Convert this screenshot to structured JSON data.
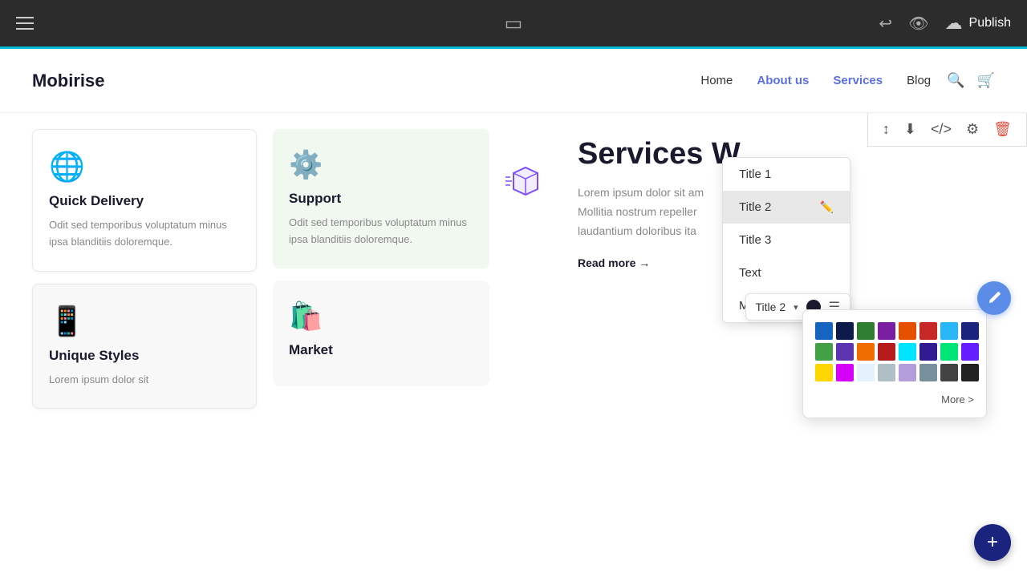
{
  "topbar": {
    "publish_label": "Publish",
    "phone_icon": "📱"
  },
  "navbar": {
    "logo": "Mobirise",
    "links": [
      {
        "label": "Home",
        "id": "home"
      },
      {
        "label": "About us",
        "id": "about"
      },
      {
        "label": "Services",
        "id": "services"
      },
      {
        "label": "Blog",
        "id": "blog"
      }
    ]
  },
  "float_toolbar": {
    "icons": [
      "↕",
      "⬇",
      "</>",
      "⚙",
      "🗑"
    ]
  },
  "cards": [
    {
      "icon": "🌐",
      "title": "Quick Delivery",
      "text": "Odit sed temporibus voluptatum minus ipsa blanditiis doloremque."
    },
    {
      "icon": "⚙",
      "title": "Support",
      "text": "Odit sed temporibus voluptatum minus ipsa blanditiis doloremque."
    }
  ],
  "cards2": [
    {
      "icon": "📱",
      "title": "Unique Styles",
      "text": "Lorem ipsum dolor sit"
    },
    {
      "icon": "🛍",
      "title": "Market",
      "text": ""
    }
  ],
  "main_section": {
    "title": "Services W",
    "description1": "Lorem ipsum dolor sit am",
    "description2": "Mollitia nostrum repeller",
    "description3": "laudantium doloribus ita",
    "read_more": "Read more →"
  },
  "dropdown": {
    "items": [
      {
        "label": "Title 1",
        "active": false
      },
      {
        "label": "Title 2",
        "active": true
      },
      {
        "label": "Title 3",
        "active": false
      },
      {
        "label": "Text",
        "active": false
      },
      {
        "label": "Menu",
        "active": false
      }
    ]
  },
  "format_bar": {
    "label": "Title 2",
    "caret": "▾"
  },
  "palette": {
    "colors": [
      "#1565c0",
      "#0d1b4b",
      "#2e7d32",
      "#7b1fa2",
      "#e65100",
      "#c62828",
      "#29b6f6",
      "#1a237e",
      "#43a047",
      "#5e35b1",
      "#ef6c00",
      "#b71c1c",
      "#00e5ff",
      "#311b92",
      "#00e676",
      "#651fff",
      "#ffd600",
      "#d500f9",
      "#e3f2fd",
      "#b0bec5",
      "#b39ddb",
      "#78909c",
      "#424242",
      "#212121"
    ],
    "more_label": "More >"
  }
}
